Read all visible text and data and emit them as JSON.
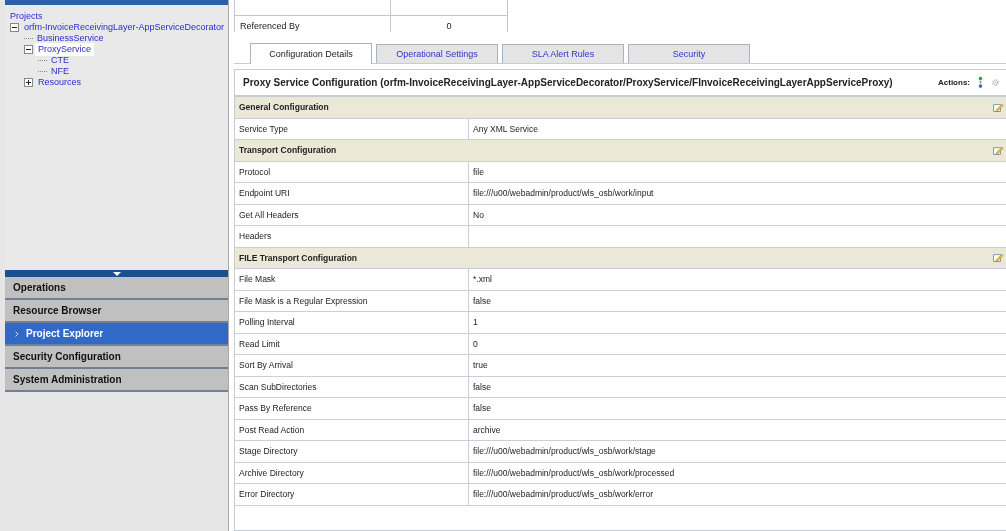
{
  "tree": {
    "root": "Projects",
    "items": [
      {
        "label": "orfm-InvoiceReceivingLayer-AppServiceDecorator",
        "expanded": true,
        "selected": false,
        "children": [
          {
            "label": "BusinessService",
            "selected": false
          },
          {
            "label": "ProxyService",
            "expanded": true,
            "selected": true,
            "children": [
              {
                "label": "CTE",
                "selected": false
              },
              {
                "label": "NFE",
                "selected": false
              }
            ]
          },
          {
            "label": "Resources",
            "expanded": false,
            "selected": false
          }
        ]
      }
    ]
  },
  "nav": [
    {
      "label": "Operations",
      "selected": false
    },
    {
      "label": "Resource Browser",
      "selected": false
    },
    {
      "label": "Project Explorer",
      "selected": true
    },
    {
      "label": "Security Configuration",
      "selected": false
    },
    {
      "label": "System Administration",
      "selected": false
    }
  ],
  "summary": [
    {
      "label": "Referenced By",
      "value": "0"
    }
  ],
  "tabs": [
    {
      "label": "Configuration Details",
      "selected": true
    },
    {
      "label": "Operational Settings",
      "selected": false
    },
    {
      "label": "SLA Alert Rules",
      "selected": false
    },
    {
      "label": "Security",
      "selected": false
    }
  ],
  "panel": {
    "title": "Proxy Service Configuration (orfm-InvoiceReceivingLayer-AppServiceDecorator/ProxyService/FInvoiceReceivingLayerAppServiceProxy)",
    "actions_label": "Actions:"
  },
  "sections": [
    {
      "title": "General Configuration",
      "rows": [
        {
          "label": "Service Type",
          "value": "Any XML Service"
        }
      ]
    },
    {
      "title": "Transport Configuration",
      "rows": [
        {
          "label": "Protocol",
          "value": "file"
        },
        {
          "label": "Endpoint URI",
          "value": "file:///u00/webadmin/product/wls_osb/work/input"
        },
        {
          "label": "Get All Headers",
          "value": "No"
        },
        {
          "label": "Headers",
          "value": ""
        }
      ]
    },
    {
      "title": "FILE Transport Configuration",
      "rows": [
        {
          "label": "File Mask",
          "value": "*.xml"
        },
        {
          "label": "File Mask is a Regular Expression",
          "value": "false"
        },
        {
          "label": "Polling Interval",
          "value": "1"
        },
        {
          "label": "Read Limit",
          "value": "0"
        },
        {
          "label": "Sort By Arrival",
          "value": "true"
        },
        {
          "label": "Scan SubDirectories",
          "value": "false"
        },
        {
          "label": "Pass By Reference",
          "value": "false"
        },
        {
          "label": "Post Read Action",
          "value": "archive"
        },
        {
          "label": "Stage Directory",
          "value": "file:///u00/webadmin/product/wls_osb/work/stage"
        },
        {
          "label": "Archive Directory",
          "value": "file:///u00/webadmin/product/wls_osb/work/processed"
        },
        {
          "label": "Error Directory",
          "value": "file:///u00/webadmin/product/wls_osb/work/error"
        }
      ]
    }
  ]
}
